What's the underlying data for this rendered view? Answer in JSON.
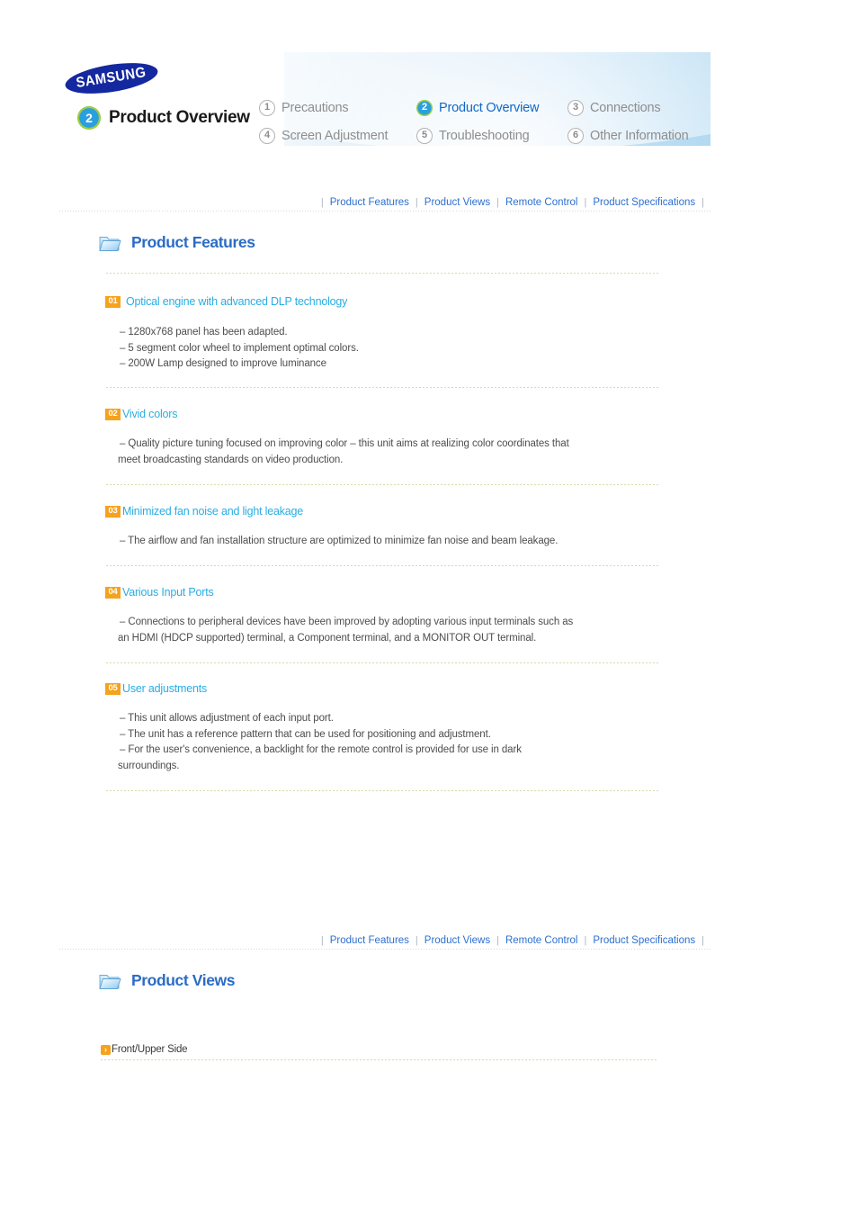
{
  "brand": {
    "logo_text": "SAMSUNG"
  },
  "header": {
    "chapter_number": "2",
    "chapter_title": "Product Overview",
    "nav_items": [
      {
        "number": "1",
        "label": "Precautions",
        "active": false
      },
      {
        "number": "2",
        "label": "Product Overview",
        "active": true
      },
      {
        "number": "3",
        "label": "Connections",
        "active": false
      },
      {
        "number": "4",
        "label": "Screen Adjustment",
        "active": false
      },
      {
        "number": "5",
        "label": "Troubleshooting",
        "active": false
      },
      {
        "number": "6",
        "label": "Other Information",
        "active": false
      }
    ]
  },
  "subnav": {
    "separator": "|",
    "links": [
      "Product Features",
      "Product Views",
      "Remote Control",
      "Product Specifications"
    ]
  },
  "sections": {
    "product_features": {
      "title": "Product Features",
      "icon": "folder-icon",
      "items": [
        {
          "badge": "01",
          "title": "Optical engine with advanced DLP technology",
          "lines": [
            "– 1280x768 panel has been adapted.",
            "– 5 segment color wheel to implement optimal colors.",
            "– 200W Lamp designed to improve luminance"
          ]
        },
        {
          "badge": "02",
          "title": "Vivid colors",
          "lines": [
            "– Quality picture tuning focused on improving color – this unit aims at realizing color coordinates that",
            "meet broadcasting standards on video production."
          ]
        },
        {
          "badge": "03",
          "title": "Minimized fan noise and light leakage",
          "lines": [
            "– The airflow and fan installation structure are optimized to minimize fan noise and beam leakage."
          ]
        },
        {
          "badge": "04",
          "title": "Various Input Ports",
          "lines": [
            "– Connections to peripheral devices have been improved by adopting various input terminals such as",
            "an HDMI (HDCP supported) terminal, a Component terminal, and a MONITOR OUT terminal."
          ]
        },
        {
          "badge": "05",
          "title": "User adjustments",
          "lines": [
            "– This unit allows adjustment of each input port.",
            "– The unit has a reference pattern that can be used for positioning and adjustment.",
            "– For the user's convenience, a backlight for the remote control is provided for use in dark",
            "surroundings."
          ]
        }
      ]
    },
    "product_views": {
      "title": "Product Views",
      "icon": "folder-icon",
      "subsection": {
        "arrow_glyph": "›",
        "label": "Front/Upper Side"
      }
    }
  },
  "colors": {
    "accent_blue": "#2b6cc4",
    "link_blue": "#2d6fd0",
    "heading_cyan": "#29ade3",
    "badge_orange": "#f5a21e",
    "samsung_navy": "#1428a0",
    "rule_green": "#cfe0a8",
    "rule_gray": "#d9d9d9"
  }
}
